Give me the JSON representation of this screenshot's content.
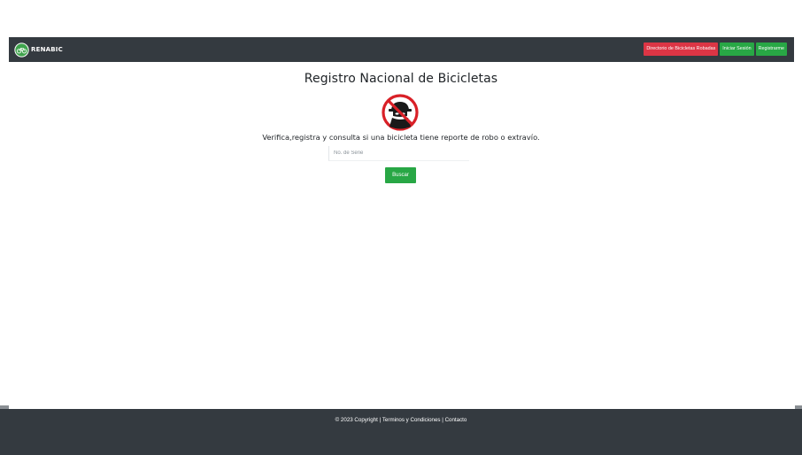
{
  "navbar": {
    "brand_text": "RENABIC",
    "buttons": {
      "stolen_directory": "Directorio de Bicicletas Robadas",
      "login": "Iniciar Sesión",
      "register": "Registrarme"
    }
  },
  "main": {
    "title": "Registro Nacional de Bicicletas",
    "subtitle": "Verifica,registra y consulta si una bicicleta tiene reporte de robo o extravío.",
    "serial_input": {
      "placeholder": "No. de Serie",
      "value": ""
    },
    "search_button": "Buscar"
  },
  "footer": {
    "copyright": "© 2023 Copyright | ",
    "terms": "Terminos y Condiciones",
    "separator": " | ",
    "contact": "Contacto"
  },
  "colors": {
    "navbar_bg": "#343a40",
    "danger": "#dc3545",
    "success": "#28a745",
    "footer_bg": "#343a40"
  },
  "icons": {
    "brand": "bicycle-logo-icon",
    "hero": "thief-prohibited-icon"
  }
}
